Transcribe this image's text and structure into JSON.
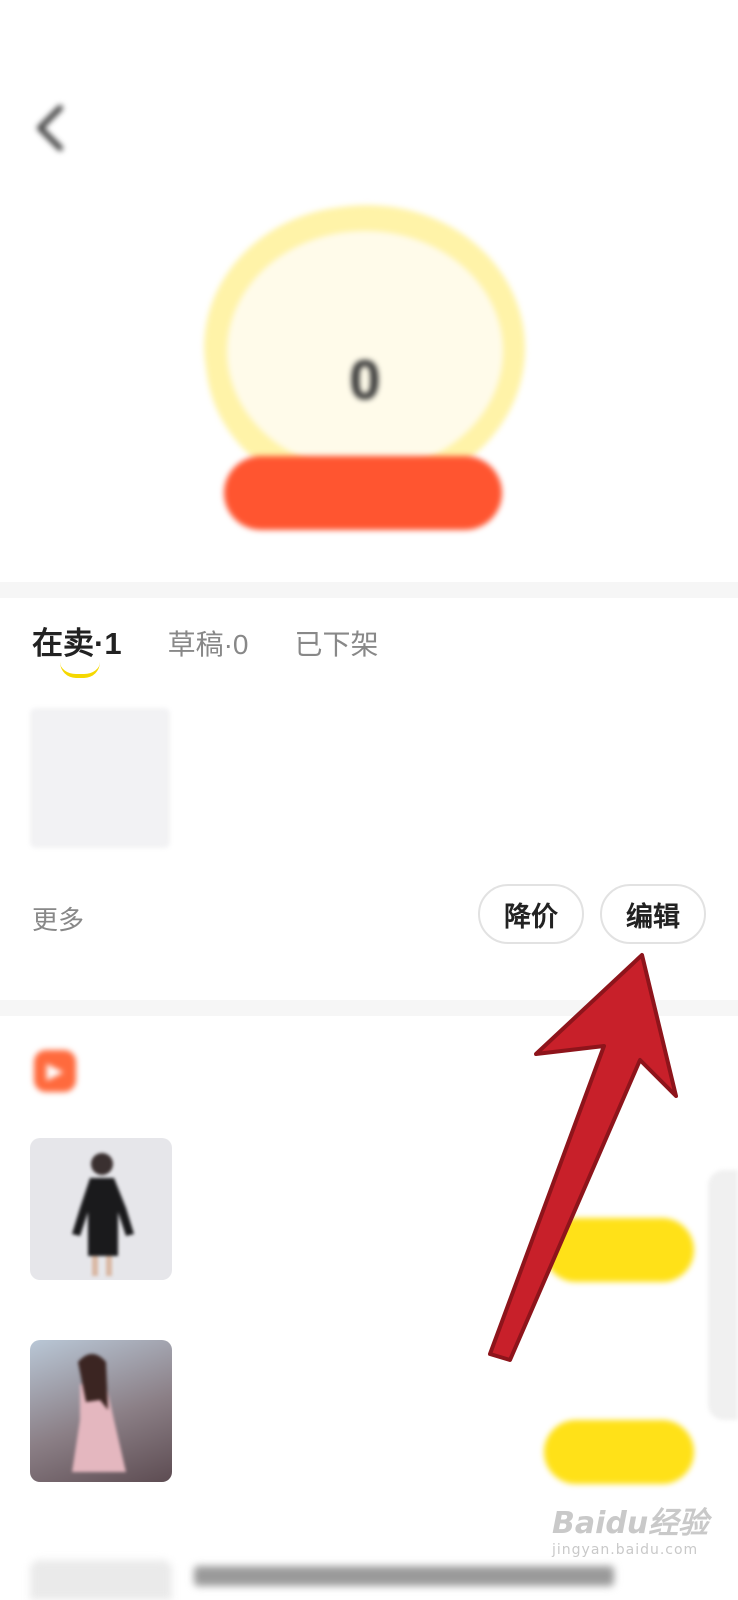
{
  "header": {
    "status_text": "",
    "title": ""
  },
  "summary": {
    "circle_label": "",
    "count": "0",
    "action_button": ""
  },
  "tabs": [
    {
      "label": "在卖·1",
      "active": true
    },
    {
      "label": "草稿·0",
      "active": false
    },
    {
      "label": "已下架",
      "active": false
    }
  ],
  "product": {
    "title": "",
    "price": "",
    "stats": ""
  },
  "actions": {
    "more_label": "更多",
    "reduce_price_label": "降价",
    "edit_label": "编辑"
  },
  "recommend": {
    "title": "",
    "items": [
      {
        "title": "",
        "price": "",
        "meta": "",
        "button": ""
      },
      {
        "title": "",
        "price": "",
        "meta": "",
        "button": ""
      }
    ]
  },
  "watermark": {
    "brand": "Baidu经验",
    "url": "jingyan.baidu.com"
  },
  "colors": {
    "accent_yellow": "#ffe118",
    "accent_orange": "#ff5530",
    "arrow_red": "#c8202a",
    "price_red": "#ff3b3b"
  }
}
